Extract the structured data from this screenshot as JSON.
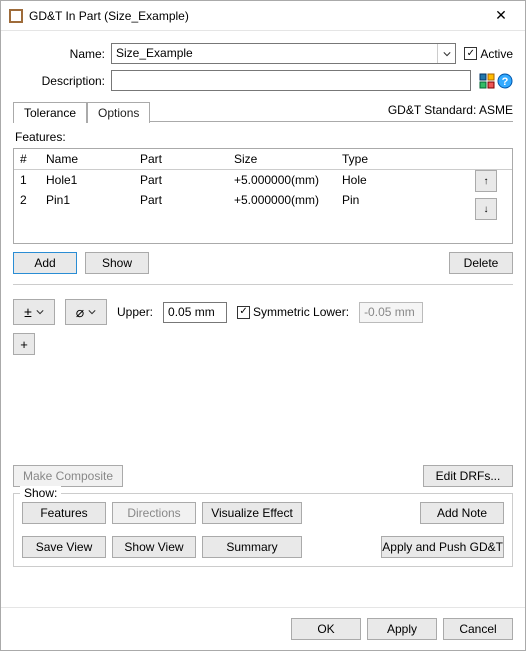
{
  "window": {
    "title": "GD&T In Part (Size_Example)"
  },
  "form": {
    "name_label": "Name:",
    "name_value": "Size_Example",
    "active_label": "Active",
    "description_label": "Description:",
    "description_value": ""
  },
  "tabs": {
    "tolerance": "Tolerance",
    "options": "Options"
  },
  "standard": "GD&T Standard: ASME",
  "features": {
    "label": "Features:",
    "columns": {
      "num": "#",
      "name": "Name",
      "part": "Part",
      "size": "Size",
      "type": "Type"
    },
    "rows": [
      {
        "num": "1",
        "name": "Hole1",
        "part": "Part",
        "size": "+5.000000(mm)",
        "type": "Hole"
      },
      {
        "num": "2",
        "name": "Pin1",
        "part": "Part",
        "size": "+5.000000(mm)",
        "type": "Pin"
      }
    ],
    "buttons": {
      "add": "Add",
      "show": "Show",
      "delete": "Delete"
    }
  },
  "tolerance": {
    "pm_symbol": "±",
    "diam_symbol": "⌀",
    "upper_label": "Upper:",
    "upper_value": "0.05 mm",
    "symmetric_label": "Symmetric Lower:",
    "lower_value": "-0.05 mm",
    "plus": "+"
  },
  "composite": {
    "make": "Make Composite",
    "edit_drfs": "Edit DRFs..."
  },
  "show": {
    "legend": "Show:",
    "features": "Features",
    "directions": "Directions",
    "visualize": "Visualize Effect",
    "add_note": "Add Note",
    "save_view": "Save View",
    "show_view": "Show View",
    "summary": "Summary",
    "apply_push": "Apply and Push GD&T"
  },
  "footer": {
    "ok": "OK",
    "apply": "Apply",
    "cancel": "Cancel"
  },
  "icons": {
    "up": "↑",
    "down": "↓",
    "check": "✓",
    "chev": "⌄",
    "close": "✕"
  }
}
